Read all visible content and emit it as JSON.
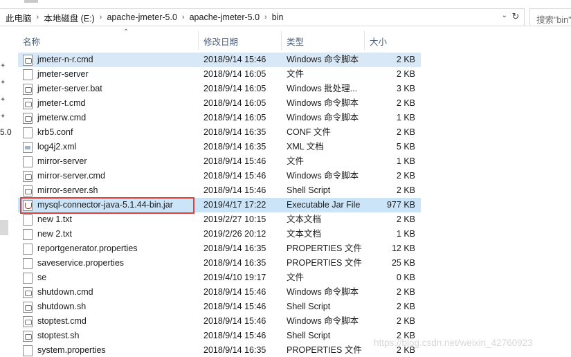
{
  "address": {
    "crumbs": [
      "此电脑",
      "本地磁盘 (E:)",
      "apache-jmeter-5.0",
      "apache-jmeter-5.0",
      "bin"
    ],
    "search_placeholder": "搜索\"bin\""
  },
  "nav": {
    "partial_label": "5.0"
  },
  "columns": {
    "name": "名称",
    "date": "修改日期",
    "type": "类型",
    "size": "大小"
  },
  "files": [
    {
      "name": "jmeter-n-r.cmd",
      "date": "2018/9/14 15:46",
      "type": "Windows 命令脚本",
      "size": "2 KB",
      "icon": "cmd-icon"
    },
    {
      "name": "jmeter-server",
      "date": "2018/9/14 16:05",
      "type": "文件",
      "size": "2 KB",
      "icon": "file-icon"
    },
    {
      "name": "jmeter-server.bat",
      "date": "2018/9/14 16:05",
      "type": "Windows 批处理...",
      "size": "3 KB",
      "icon": "cmd-icon"
    },
    {
      "name": "jmeter-t.cmd",
      "date": "2018/9/14 16:05",
      "type": "Windows 命令脚本",
      "size": "2 KB",
      "icon": "cmd-icon"
    },
    {
      "name": "jmeterw.cmd",
      "date": "2018/9/14 16:05",
      "type": "Windows 命令脚本",
      "size": "1 KB",
      "icon": "cmd-icon"
    },
    {
      "name": "krb5.conf",
      "date": "2018/9/14 16:35",
      "type": "CONF 文件",
      "size": "2 KB",
      "icon": "file-icon"
    },
    {
      "name": "log4j2.xml",
      "date": "2018/9/14 16:35",
      "type": "XML 文档",
      "size": "5 KB",
      "icon": "xml-icon"
    },
    {
      "name": "mirror-server",
      "date": "2018/9/14 15:46",
      "type": "文件",
      "size": "1 KB",
      "icon": "file-icon"
    },
    {
      "name": "mirror-server.cmd",
      "date": "2018/9/14 15:46",
      "type": "Windows 命令脚本",
      "size": "2 KB",
      "icon": "cmd-icon"
    },
    {
      "name": "mirror-server.sh",
      "date": "2018/9/14 15:46",
      "type": "Shell Script",
      "size": "2 KB",
      "icon": "cmd-icon"
    },
    {
      "name": "mysql-connector-java-5.1.44-bin.jar",
      "date": "2019/4/17 17:22",
      "type": "Executable Jar File",
      "size": "977 KB",
      "icon": "jar-icon"
    },
    {
      "name": "new 1.txt",
      "date": "2019/2/27 10:15",
      "type": "文本文档",
      "size": "2 KB",
      "icon": "file-icon"
    },
    {
      "name": "new 2.txt",
      "date": "2019/2/26 20:12",
      "type": "文本文档",
      "size": "1 KB",
      "icon": "file-icon"
    },
    {
      "name": "reportgenerator.properties",
      "date": "2018/9/14 16:35",
      "type": "PROPERTIES 文件",
      "size": "12 KB",
      "icon": "file-icon"
    },
    {
      "name": "saveservice.properties",
      "date": "2018/9/14 16:35",
      "type": "PROPERTIES 文件",
      "size": "25 KB",
      "icon": "file-icon"
    },
    {
      "name": "se",
      "date": "2019/4/10 19:17",
      "type": "文件",
      "size": "0 KB",
      "icon": "file-icon"
    },
    {
      "name": "shutdown.cmd",
      "date": "2018/9/14 15:46",
      "type": "Windows 命令脚本",
      "size": "2 KB",
      "icon": "cmd-icon"
    },
    {
      "name": "shutdown.sh",
      "date": "2018/9/14 15:46",
      "type": "Shell Script",
      "size": "2 KB",
      "icon": "cmd-icon"
    },
    {
      "name": "stoptest.cmd",
      "date": "2018/9/14 15:46",
      "type": "Windows 命令脚本",
      "size": "2 KB",
      "icon": "cmd-icon"
    },
    {
      "name": "stoptest.sh",
      "date": "2018/9/14 15:46",
      "type": "Shell Script",
      "size": "2 KB",
      "icon": "cmd-icon"
    },
    {
      "name": "system.properties",
      "date": "2018/9/14 16:35",
      "type": "PROPERTIES 文件",
      "size": "2 KB",
      "icon": "file-icon"
    }
  ],
  "watermark": "https://blog.csdn.net/weixin_42760923"
}
